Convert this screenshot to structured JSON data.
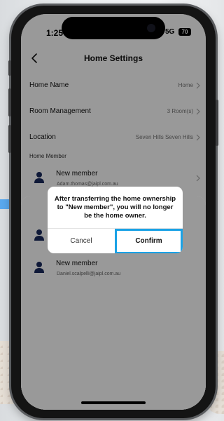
{
  "status": {
    "time": "1:25",
    "network": "5G",
    "battery": "70"
  },
  "nav": {
    "title": "Home Settings"
  },
  "settings": [
    {
      "label": "Home Name",
      "value": "Home"
    },
    {
      "label": "Room Management",
      "value": "3 Room(s)"
    },
    {
      "label": "Location",
      "value": "Seven Hills Seven Hills"
    }
  ],
  "section": {
    "members_title": "Home Member"
  },
  "members": [
    {
      "name": "New member",
      "email": "Adam.thomas@jaipl.com.au"
    }
  ],
  "sheet_members": [
    {
      "name": "",
      "email": ""
    },
    {
      "name": "New member",
      "email": "Daniel.scalpelli@jaipl.com.au"
    }
  ],
  "dialog": {
    "message": "After transferring the home ownership to \"New member\", you will no longer be the home owner.",
    "cancel_label": "Cancel",
    "confirm_label": "Confirm"
  },
  "colors": {
    "highlight": "#1aa2e6",
    "dim_overlay": "rgba(0,0,0,0.40)"
  },
  "icons": {
    "back": "chevron-left-icon",
    "row_chevron": "chevron-right-icon",
    "avatar": "person-icon"
  }
}
